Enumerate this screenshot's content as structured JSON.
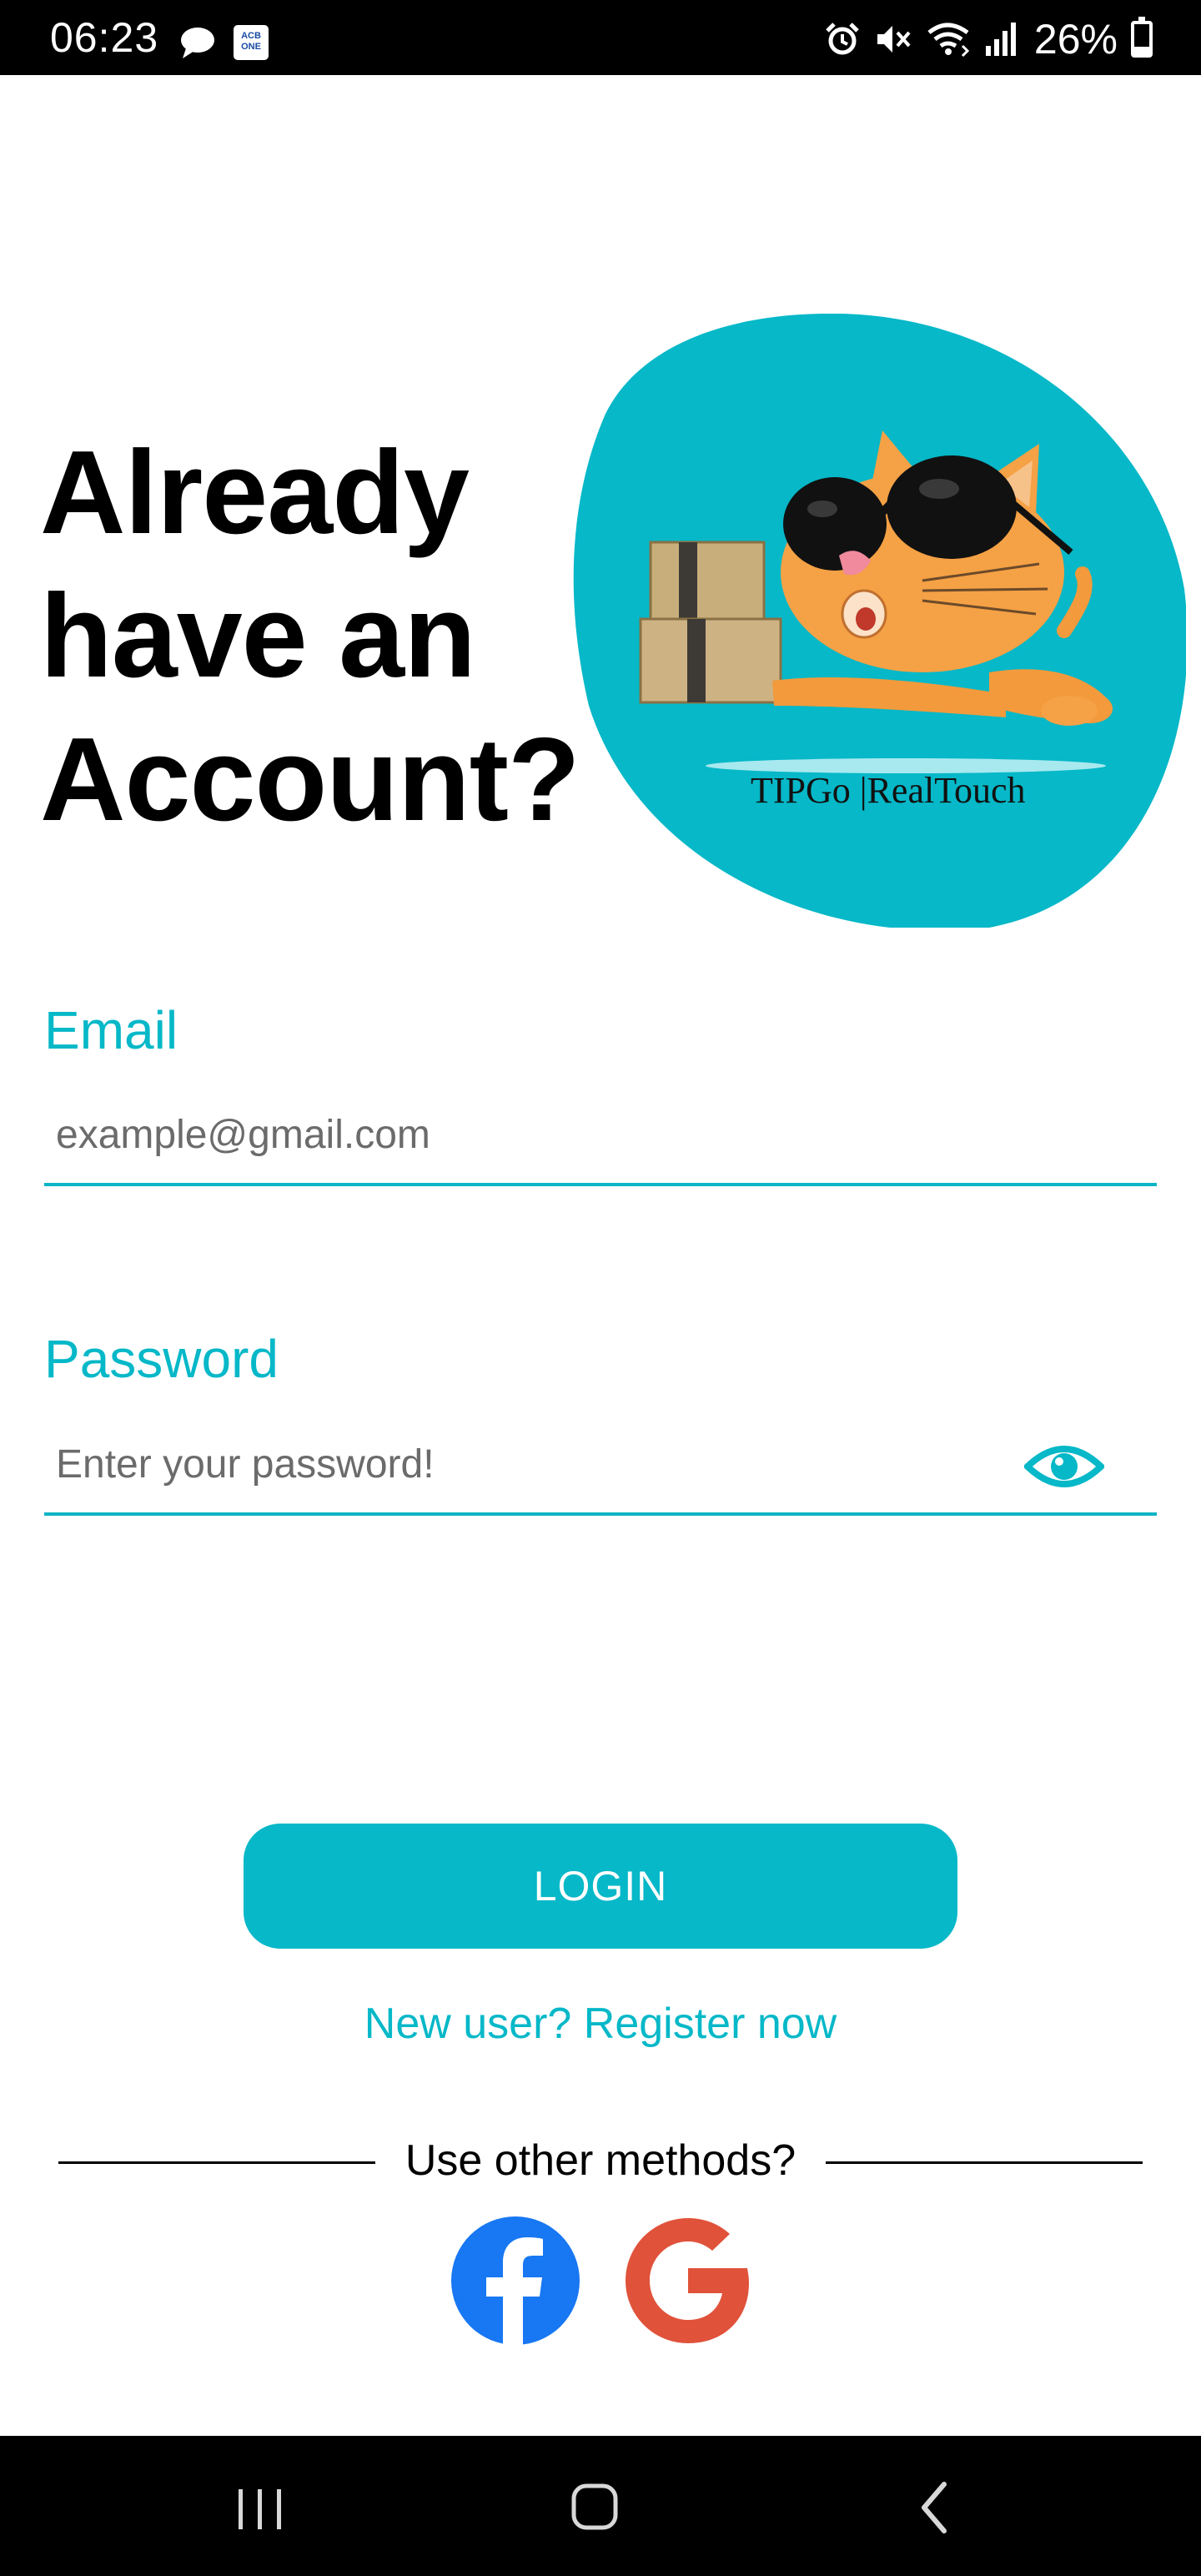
{
  "status_bar": {
    "time": "06:23",
    "battery": "26%",
    "battery_level": 0.26,
    "bank_icon_text": "ACB ONE",
    "icons": [
      "chat-bubble-icon",
      "acb-app-icon",
      "alarm-icon",
      "mute-icon",
      "wifi-icon",
      "signal-icon",
      "battery-icon"
    ]
  },
  "headline": {
    "line1": "Already",
    "line2": "have an",
    "line3": "Account?"
  },
  "illustration": {
    "brand_text": "TIPGo |RealTouch",
    "blob_color": "#06b8c8",
    "icon": "cat-with-boxes-mascot"
  },
  "form": {
    "email_label": "Email",
    "email_placeholder": "example@gmail.com",
    "email_value": "",
    "password_label": "Password",
    "password_placeholder": "Enter your password!",
    "password_value": "",
    "eye_icon": "eye-icon"
  },
  "actions": {
    "login_label": "LOGIN",
    "register_label": "New user? Register now"
  },
  "social": {
    "divider_text": "Use other methods?",
    "providers": [
      {
        "name": "facebook",
        "icon": "facebook-icon",
        "color": "#1877f2"
      },
      {
        "name": "google",
        "icon": "google-icon",
        "color": "#e0523a"
      }
    ]
  },
  "nav_bar": {
    "buttons": [
      "recent-apps-icon",
      "home-icon",
      "back-icon"
    ]
  },
  "colors": {
    "accent": "#06b8c8",
    "text": "#000000",
    "placeholder": "#6b6b6b"
  }
}
